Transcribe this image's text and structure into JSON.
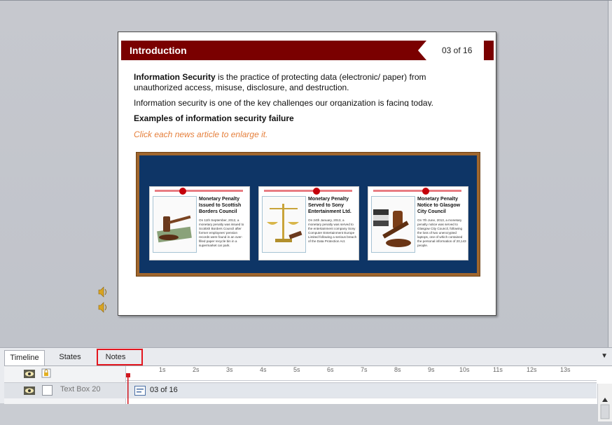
{
  "slide": {
    "title": "Introduction",
    "page": "03 of 16",
    "intro_bold": "Information Security",
    "intro_rest": " is the practice of protecting data (electronic/ paper) from unauthorized access, misuse, disclosure, and destruction.",
    "para2": "Information security is one of the key challenges our organization is facing today.",
    "heading": "Examples of information security failure",
    "hint": "Click each news article to enlarge it.",
    "articles": [
      {
        "title": "Monetary Penalty Issued to Scottish Borders Council",
        "body": "On 11th September, 2012, a monetary penalty was issued to Scottish Borders Council after former employees' pension records were found in an over-filled paper recycle bin in a supermarket car park."
      },
      {
        "title": "Monetary Penalty Served to Sony Entertainment Ltd.",
        "body": "On 24th January, 2013, a monetary penalty was served to the entertainment company Sony Computer Entertainment Europe Limited following a serious breach of the Data Protection Act."
      },
      {
        "title": "Monetary Penalty Notice to Glasgow City Council",
        "body": "On 7th June, 2013, a monetary penalty notice was served to Glasgow City Council, following the loss of two unencrypted laptops, one of which contained the personal information of 20,143 people."
      }
    ]
  },
  "panel": {
    "tabs": [
      "Timeline",
      "States",
      "Notes"
    ],
    "ruler": [
      "1s",
      "2s",
      "3s",
      "4s",
      "5s",
      "6s",
      "7s",
      "8s",
      "9s",
      "10s",
      "11s",
      "12s",
      "13s"
    ],
    "layer_name": "Text Box 20",
    "item_text": "03 of 16"
  },
  "colors": {
    "title_bar": "#7a0000",
    "hint": "#e57f3b",
    "board": "#0e3566",
    "highlight": "#e3161e"
  }
}
